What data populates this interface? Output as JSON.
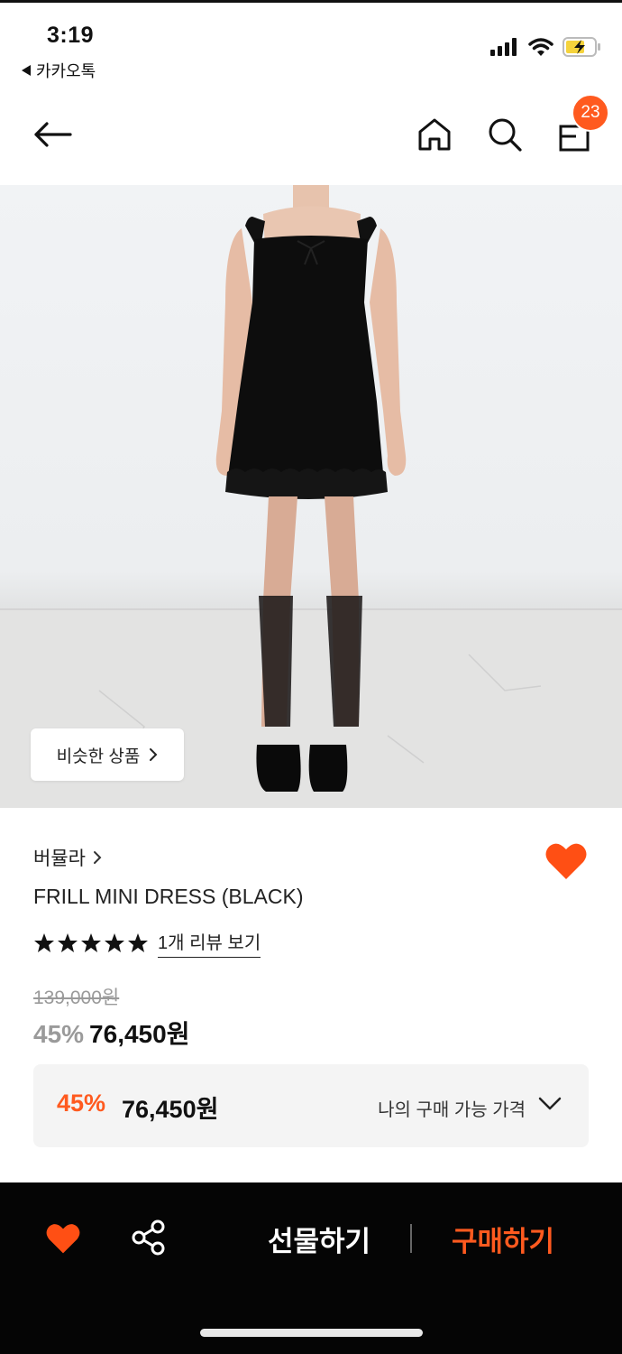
{
  "status": {
    "time": "3:19",
    "back_app": "카카오톡"
  },
  "header": {
    "cart_count": "23",
    "icons": [
      "back-arrow-icon",
      "home-icon",
      "search-icon",
      "shopping-bag-icon"
    ]
  },
  "image": {
    "similar_button": "비슷한 상품"
  },
  "product": {
    "brand": "버뮬라",
    "name": "FRILL MINI DRESS (BLACK)",
    "rating_stars": 5,
    "review_link": "1개 리뷰 보기",
    "original_price": "139,000원",
    "discount": "45%",
    "sale_price": "76,450원"
  },
  "my_price": {
    "discount": "45%",
    "price": "76,450원",
    "label": "나의 구매 가능 가격"
  },
  "bottom": {
    "gift": "선물하기",
    "buy": "구매하기"
  },
  "colors": {
    "accent": "#ff5a1f",
    "bar": "#050505",
    "box": "#f4f4f4"
  }
}
